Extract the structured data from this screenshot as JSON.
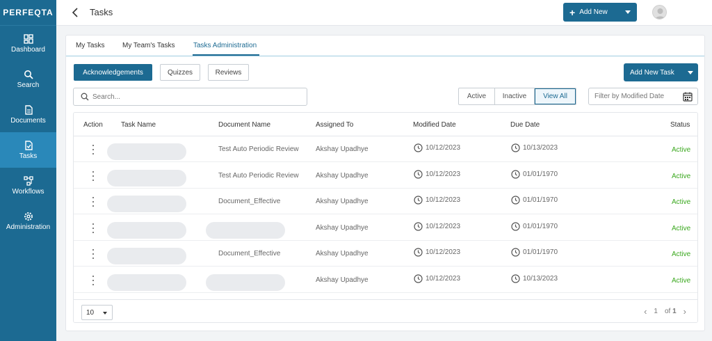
{
  "sidebar": {
    "logo": "PERFEQTA",
    "items": [
      {
        "label": "Dashboard"
      },
      {
        "label": "Search"
      },
      {
        "label": "Documents"
      },
      {
        "label": "Tasks"
      },
      {
        "label": "Workflows"
      },
      {
        "label": "Administration"
      }
    ]
  },
  "header": {
    "title": "Tasks",
    "add_new_label": "Add New"
  },
  "tabs": [
    {
      "label": "My Tasks"
    },
    {
      "label": "My Team's Tasks"
    },
    {
      "label": "Tasks Administration"
    }
  ],
  "categories": [
    {
      "label": "Acknowledgements"
    },
    {
      "label": "Quizzes"
    },
    {
      "label": "Reviews"
    }
  ],
  "add_task_label": "Add New Task",
  "search": {
    "placeholder": "Search..."
  },
  "filters": [
    {
      "label": "Active"
    },
    {
      "label": "Inactive"
    },
    {
      "label": "View All"
    }
  ],
  "date_filter": {
    "placeholder": "Filter by Modified Date"
  },
  "table": {
    "columns": [
      "Action",
      "Task Name",
      "Document Name",
      "Assigned To",
      "Modified Date",
      "Due Date",
      "Status"
    ],
    "rows": [
      {
        "document": "Test Auto Periodic Review",
        "assigned": "Akshay Upadhye",
        "modified": "10/12/2023",
        "due": "10/13/2023",
        "status": "Active"
      },
      {
        "document": "Test Auto Periodic Review",
        "assigned": "Akshay Upadhye",
        "modified": "10/12/2023",
        "due": "01/01/1970",
        "status": "Active"
      },
      {
        "document": "Document_Effective",
        "assigned": "Akshay Upadhye",
        "modified": "10/12/2023",
        "due": "01/01/1970",
        "status": "Active"
      },
      {
        "document": "",
        "assigned": "Akshay Upadhye",
        "modified": "10/12/2023",
        "due": "01/01/1970",
        "status": "Active"
      },
      {
        "document": "Document_Effective",
        "assigned": "Akshay Upadhye",
        "modified": "10/12/2023",
        "due": "01/01/1970",
        "status": "Active"
      },
      {
        "document": "",
        "assigned": "Akshay Upadhye",
        "modified": "10/12/2023",
        "due": "10/13/2023",
        "status": "Active"
      }
    ]
  },
  "pagination": {
    "page_size": "10",
    "current_page": "1",
    "of_label": "of",
    "total_pages": "1"
  },
  "colors": {
    "primary": "#1c6a92",
    "status_active": "#3aa81e"
  }
}
